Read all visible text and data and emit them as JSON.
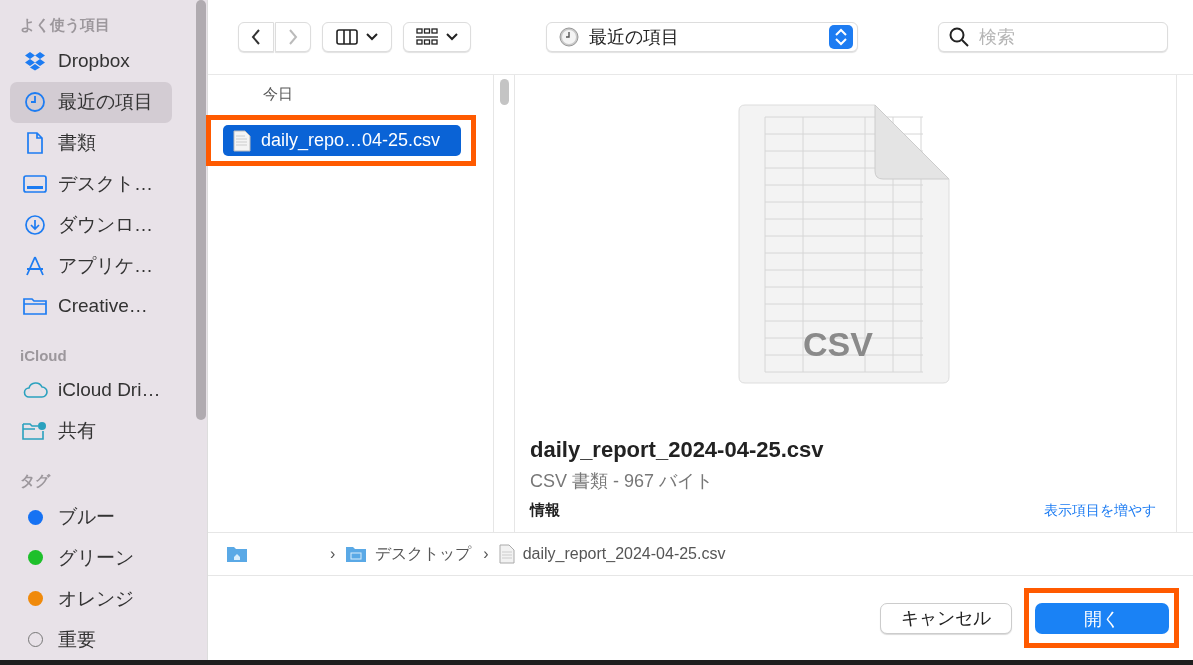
{
  "sidebar": {
    "sections": [
      {
        "title": "よく使う項目",
        "items": [
          {
            "kind": "place",
            "label": "Dropbox",
            "selected": false
          },
          {
            "kind": "place",
            "label": "最近の項目",
            "selected": true
          },
          {
            "kind": "place",
            "label": "書類",
            "selected": false
          },
          {
            "kind": "place",
            "label": "デスクト…",
            "selected": false
          },
          {
            "kind": "place",
            "label": "ダウンロ…",
            "selected": false
          },
          {
            "kind": "place",
            "label": "アプリケ…",
            "selected": false
          },
          {
            "kind": "place",
            "label": "Creative…",
            "selected": false
          }
        ]
      },
      {
        "title": "iCloud",
        "items": [
          {
            "kind": "place",
            "label": "iCloud Dri…",
            "selected": false
          },
          {
            "kind": "place",
            "label": "共有",
            "selected": false
          }
        ]
      },
      {
        "title": "タグ",
        "items": [
          {
            "kind": "tag",
            "label": "ブルー",
            "color": "#1672f3",
            "selected": false
          },
          {
            "kind": "tag",
            "label": "グリーン",
            "color": "#1ec02b",
            "selected": false
          },
          {
            "kind": "tag",
            "label": "オレンジ",
            "color": "#f08a0b",
            "selected": false
          },
          {
            "kind": "tag-empty",
            "label": "重要",
            "selected": false
          }
        ]
      }
    ]
  },
  "toolbar": {
    "back_disabled": false,
    "forward_disabled": true,
    "location": "最近の項目",
    "search": {
      "placeholder": "検索"
    }
  },
  "file_list": {
    "group": "今日",
    "items": [
      {
        "name": "daily_repo…04-25.csv",
        "selected": true,
        "highlighted": true
      }
    ]
  },
  "preview": {
    "thumbnail_label": "CSV",
    "title": "daily_report_2024-04-25.csv",
    "subtitle": "CSV 書類 - 967 バイト",
    "info_label": "情報",
    "more_link": "表示項目を増やす"
  },
  "path_bar": [
    {
      "kind": "folder"
    },
    {
      "kind": "folder",
      "separator": "›",
      "label": "デスクトップ"
    },
    {
      "kind": "file",
      "separator": "›",
      "label": "daily_report_2024-04-25.csv"
    }
  ],
  "buttons": [
    {
      "label": "キャンセル",
      "kind": "secondary",
      "highlighted": false
    },
    {
      "label": "開く",
      "kind": "primary",
      "highlighted": true
    }
  ]
}
